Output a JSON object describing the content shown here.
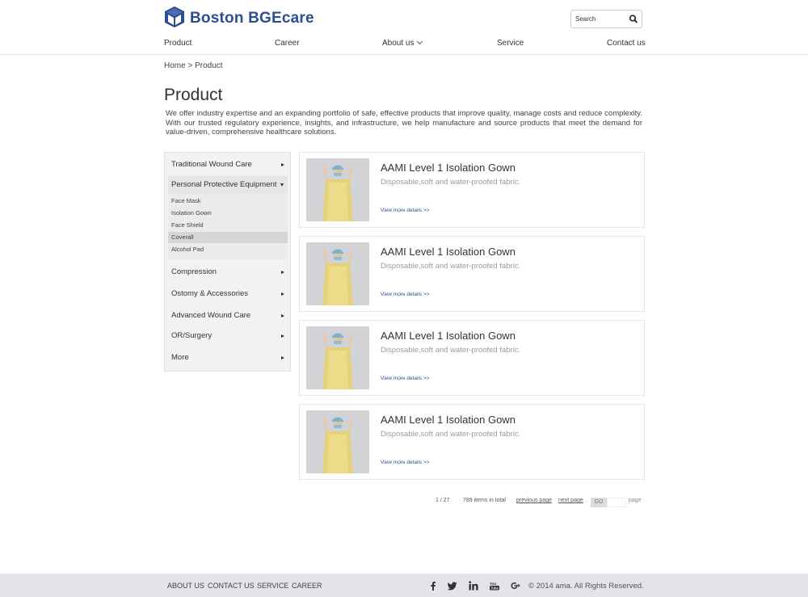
{
  "brand": {
    "name": "Boston BGEcare",
    "mark_caption": "BGEcare"
  },
  "search": {
    "placeholder": "Search"
  },
  "nav": [
    {
      "label": "Product"
    },
    {
      "label": "Career"
    },
    {
      "label": "About us"
    },
    {
      "label": "Service"
    },
    {
      "label": "Contact us"
    }
  ],
  "breadcrumb": "Home > Product",
  "page": {
    "title": "Product",
    "intro": "We offer industry expertise and an expanding portfolio of safe, effective products that improve quality, manage costs and reduce complexity. With our trusted regulatory experience, insights, and infrastructure, we help manufacture and source products that meet the demand for value-driven, comprehensive healthcare solutions."
  },
  "sidebar": {
    "items": [
      {
        "label": "Traditional Wound Care"
      },
      {
        "label": "Personal Protective Equipment"
      },
      {
        "label": "Compression"
      },
      {
        "label": "Ostomy & Accessories"
      },
      {
        "label": "Advanced Wound Care"
      },
      {
        "label": "OR/Surgery"
      },
      {
        "label": "More"
      }
    ],
    "expanded": "Personal Protective Equipment",
    "subitems": [
      {
        "label": "Face Mask"
      },
      {
        "label": "Isolation Gown"
      },
      {
        "label": "Face Shield"
      },
      {
        "label": "Coverall"
      },
      {
        "label": "Alcohol Pad"
      }
    ],
    "selected_subitem": "Coverall"
  },
  "products": [
    {
      "title": "AAMI Level 1 Isolation Gown",
      "desc": "Disposable,soft and water-proofed fabric.",
      "link": "View more details >>"
    },
    {
      "title": "AAMI Level 1 Isolation Gown",
      "desc": "Disposable,soft and water-proofed fabric.",
      "link": "View more details >>"
    },
    {
      "title": "AAMI Level 1 Isolation Gown",
      "desc": "Disposable,soft and water-proofed fabric.",
      "link": "View more details >>"
    },
    {
      "title": "AAMI Level 1 Isolation Gown",
      "desc": "Disposable,soft and water-proofed fabric.",
      "link": "View more details >>"
    }
  ],
  "pagination": {
    "page_info": "1 / 27",
    "total": "789 items in total",
    "prev": "previous page",
    "next": "next page",
    "go": "GO",
    "page_word": "page"
  },
  "footer": {
    "links": [
      {
        "label": "ABOUT US"
      },
      {
        "label": "CONTACT US"
      },
      {
        "label": "SERVICE"
      },
      {
        "label": "CAREER"
      }
    ],
    "social": [
      "facebook-icon",
      "twitter-icon",
      "linkedin-icon",
      "youtube-icon",
      "google-plus-icon"
    ],
    "copyright": "© 2014 ama. All Rights Reserved."
  },
  "colors": {
    "brand": "#2d4e8f",
    "footer_bg": "#e3e3e8",
    "sidebar_bg": "#f2f2f2"
  }
}
